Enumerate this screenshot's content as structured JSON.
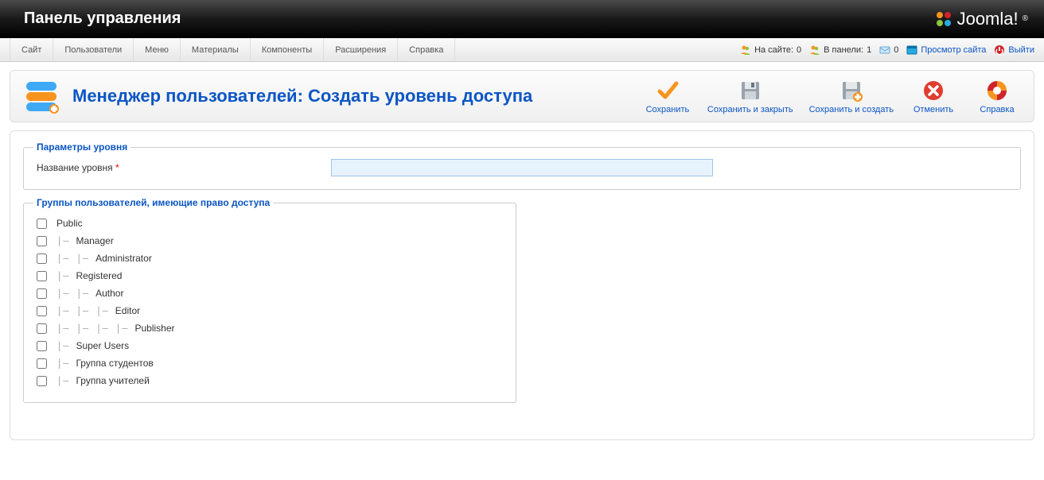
{
  "header": {
    "title": "Панель управления",
    "logo_text": "Joomla!"
  },
  "menubar": {
    "items": [
      "Сайт",
      "Пользователи",
      "Меню",
      "Материалы",
      "Компоненты",
      "Расширения",
      "Справка"
    ]
  },
  "status": {
    "on_site_label": "На сайте:",
    "on_site_count": "0",
    "in_panel_label": "В панели:",
    "in_panel_count": "1",
    "messages_count": "0",
    "view_site": "Просмотр сайта",
    "logout": "Выйти"
  },
  "page": {
    "title": "Менеджер пользователей: Создать уровень доступа"
  },
  "toolbar": {
    "save": "Сохранить",
    "save_close": "Сохранить и закрыть",
    "save_new": "Сохранить и создать",
    "cancel": "Отменить",
    "help": "Справка"
  },
  "fieldset_level": {
    "legend": "Параметры уровня",
    "name_label": "Название уровня",
    "name_value": ""
  },
  "fieldset_groups": {
    "legend": "Группы пользователей, имеющие право доступа",
    "groups": [
      {
        "depth": 0,
        "label": "Public"
      },
      {
        "depth": 1,
        "label": "Manager"
      },
      {
        "depth": 2,
        "label": "Administrator"
      },
      {
        "depth": 1,
        "label": "Registered"
      },
      {
        "depth": 2,
        "label": "Author"
      },
      {
        "depth": 3,
        "label": "Editor"
      },
      {
        "depth": 4,
        "label": "Publisher"
      },
      {
        "depth": 1,
        "label": "Super Users"
      },
      {
        "depth": 1,
        "label": "Группа студентов"
      },
      {
        "depth": 1,
        "label": "Группа учителей"
      }
    ]
  }
}
